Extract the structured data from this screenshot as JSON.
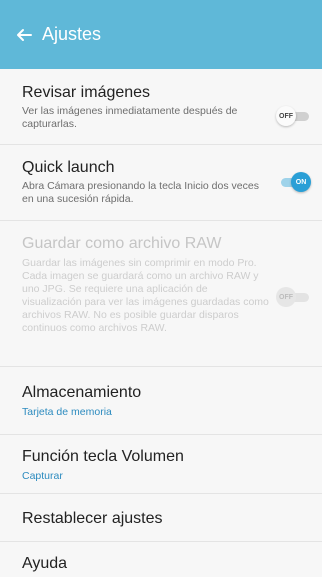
{
  "header": {
    "title": "Ajustes",
    "back_icon": "arrow-left-icon",
    "bg_color": "#5fb8d8"
  },
  "settings": [
    {
      "title": "Revisar imágenes",
      "description": "Ver las imágenes inmediatamente después de capturarlas.",
      "switch": "OFF"
    },
    {
      "title": "Quick launch",
      "description": "Abra Cámara presionando la tecla Inicio dos veces en una sucesión rápida.",
      "switch": "ON"
    },
    {
      "title": "Guardar como archivo RAW",
      "description": "Guardar las imágenes sin comprimir en modo Pro. Cada imagen se guardará como un archivo RAW y uno JPG. Se requiere una aplicación de visualización para ver las imágenes guardadas como archivos RAW. No es posible guardar disparos continuos como archivos RAW.",
      "switch": "OFF",
      "disabled": true
    },
    {
      "title": "Almacenamiento",
      "value": "Tarjeta de memoria"
    },
    {
      "title": "Función tecla Volumen",
      "value": "Capturar"
    },
    {
      "title": "Restablecer ajustes"
    },
    {
      "title": "Ayuda"
    }
  ],
  "colors": {
    "accent": "#2a9fd6",
    "link_text": "#2c8bbf"
  }
}
